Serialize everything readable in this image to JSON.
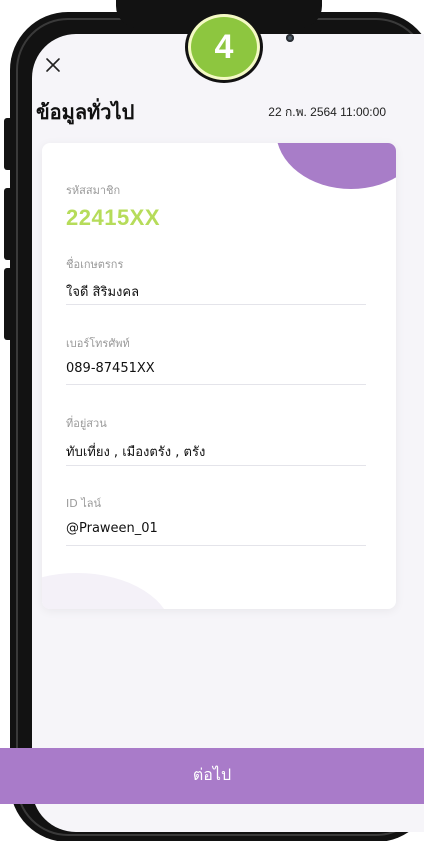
{
  "step": {
    "number": "4"
  },
  "header": {
    "title": "ข้อมูลทั่วไป",
    "datetime": "22 ก.พ. 2564  11:00:00"
  },
  "icons": {
    "close": "close-icon"
  },
  "card": {
    "member_id": {
      "label": "รหัสสมาชิก",
      "value": "22415XX"
    },
    "farmer_name": {
      "label": "ชื่อเกษตรกร",
      "value": "ใจดี สิริมงคล"
    },
    "phone": {
      "label": "เบอร์โทรศัพท์",
      "value": "089-87451XX"
    },
    "garden_address": {
      "label": "ที่อยู่สวน",
      "value": "ทับเที่ยง , เมืองตรัง , ตรัง"
    },
    "line_id": {
      "label": "ID ไลน์",
      "value": "@Praween_01"
    }
  },
  "footer": {
    "next_label": "ต่อไป"
  },
  "colors": {
    "accent": "#a97bc9",
    "member_id": "#b6dc5a",
    "badge": "#8dc63f"
  }
}
